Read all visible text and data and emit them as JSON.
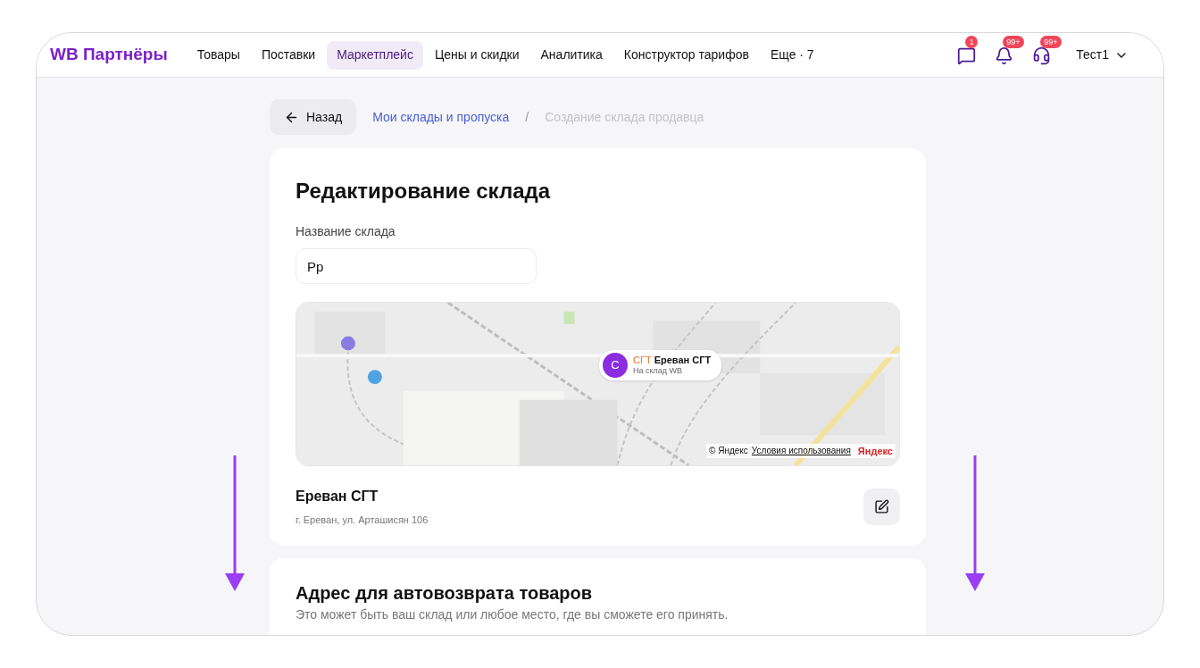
{
  "header": {
    "logo": "WB Партнёры",
    "nav": [
      {
        "label": "Товары",
        "selected": false
      },
      {
        "label": "Поставки",
        "selected": false
      },
      {
        "label": "Маркетплейс",
        "selected": true
      },
      {
        "label": "Цены и скидки",
        "selected": false
      },
      {
        "label": "Аналитика",
        "selected": false
      },
      {
        "label": "Конструктор тарифов",
        "selected": false
      },
      {
        "label": "Еще · 7",
        "selected": false
      }
    ],
    "icons": [
      {
        "kind": "chat",
        "badge": "1"
      },
      {
        "kind": "bell",
        "badge": "99+"
      },
      {
        "kind": "headset",
        "badge": "99+"
      }
    ],
    "user": "Тест1"
  },
  "breadcrumbs": {
    "back": "Назад",
    "link": "Мои склады и пропуска",
    "separator": "/",
    "current": "Создание склада продавца"
  },
  "card": {
    "title": "Редактирование склада",
    "name_label": "Название склада",
    "name_value": "Рр",
    "map": {
      "kind": "picture",
      "pin_letter": "С",
      "pin_tag": "СГТ",
      "pin_title": "Ереван СГТ",
      "pin_subtitle": "На склад WB",
      "copyright": "© Яндекс",
      "terms": "Условия использования",
      "brand": "Яндекс"
    },
    "warehouse": {
      "name": "Ереван СГТ",
      "address": "г. Ереван, ул. Арташисян 106"
    }
  },
  "return_card": {
    "title": "Адрес для автовозврата товаров",
    "subtitle": "Это может быть ваш склад или любое место, где вы сможете его принять."
  }
}
